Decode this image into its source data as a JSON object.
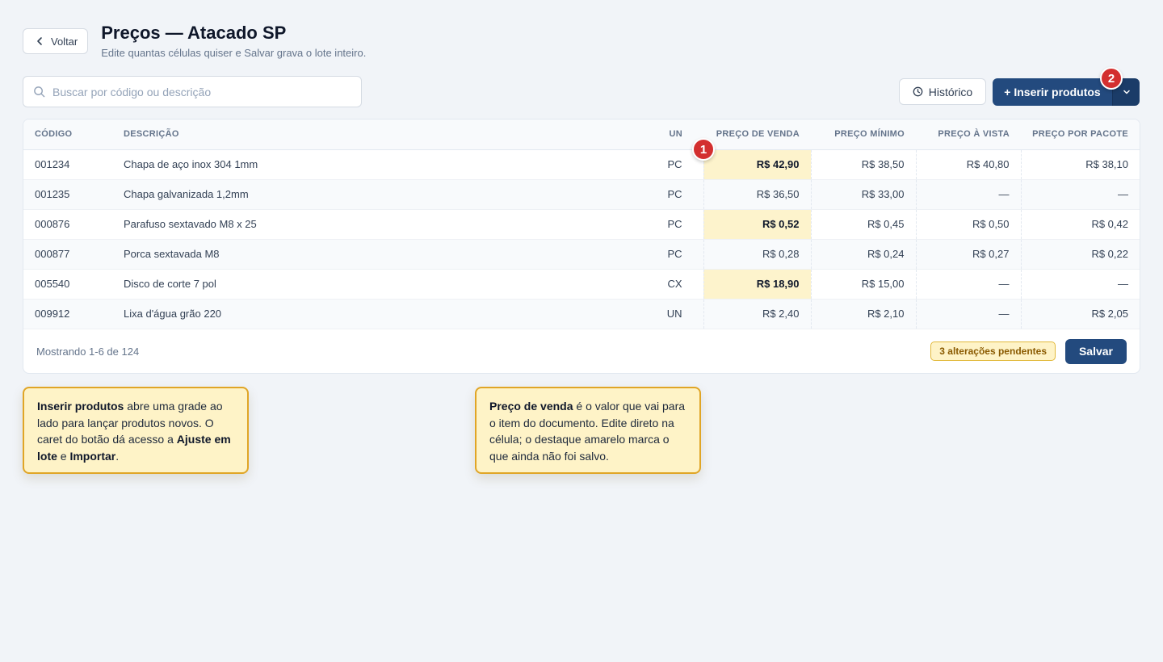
{
  "header": {
    "back_label": "Voltar",
    "title": "Preços — Atacado SP",
    "subtitle": "Edite quantas células quiser e Salvar grava o lote inteiro."
  },
  "search": {
    "placeholder": "Buscar por código ou descrição"
  },
  "toolbar": {
    "history_label": "Histórico",
    "insert_label": "+ Inserir produtos"
  },
  "badges": {
    "one": "1",
    "two": "2"
  },
  "table": {
    "columns": [
      "CÓDIGO",
      "DESCRIÇÃO",
      "UN",
      "PREÇO DE VENDA",
      "PREÇO MÍNIMO",
      "PREÇO À VISTA",
      "PREÇO POR PACOTE"
    ],
    "rows": [
      {
        "code": "001234",
        "desc": "Chapa de aço inox 304 1mm",
        "un": "PC",
        "sale": "R$ 42,90",
        "min": "R$ 38,50",
        "cash": "R$ 40,80",
        "pack": "R$ 38,10",
        "pending": true
      },
      {
        "code": "001235",
        "desc": "Chapa galvanizada 1,2mm",
        "un": "PC",
        "sale": "R$ 36,50",
        "min": "R$ 33,00",
        "cash": "—",
        "pack": "—",
        "pending": false
      },
      {
        "code": "000876",
        "desc": "Parafuso sextavado M8 x 25",
        "un": "PC",
        "sale": "R$ 0,52",
        "min": "R$ 0,45",
        "cash": "R$ 0,50",
        "pack": "R$ 0,42",
        "pending": true
      },
      {
        "code": "000877",
        "desc": "Porca sextavada M8",
        "un": "PC",
        "sale": "R$ 0,28",
        "min": "R$ 0,24",
        "cash": "R$ 0,27",
        "pack": "R$ 0,22",
        "pending": false
      },
      {
        "code": "005540",
        "desc": "Disco de corte 7 pol",
        "un": "CX",
        "sale": "R$ 18,90",
        "min": "R$ 15,00",
        "cash": "—",
        "pack": "—",
        "pending": true
      },
      {
        "code": "009912",
        "desc": "Lixa d'água grão 220",
        "un": "UN",
        "sale": "R$ 2,40",
        "min": "R$ 2,10",
        "cash": "—",
        "pack": "R$ 2,05",
        "pending": false
      }
    ]
  },
  "footer": {
    "showing": "Mostrando 1-6 de 124",
    "pending_badge": "3 alterações pendentes",
    "save_label": "Salvar"
  },
  "callouts": {
    "insert": {
      "b1": "Inserir produtos",
      "t1": " abre uma grade ao lado para lançar produtos novos. O caret do botão dá acesso a ",
      "b2": "Ajuste em lote",
      "t2": " e ",
      "b3": "Importar",
      "t3": "."
    },
    "price": {
      "b1": "Preço de venda",
      "t1": " é o valor que vai para o item do documento. Edite direto na célula; o destaque amarelo marca o que ainda não foi salvo."
    }
  }
}
